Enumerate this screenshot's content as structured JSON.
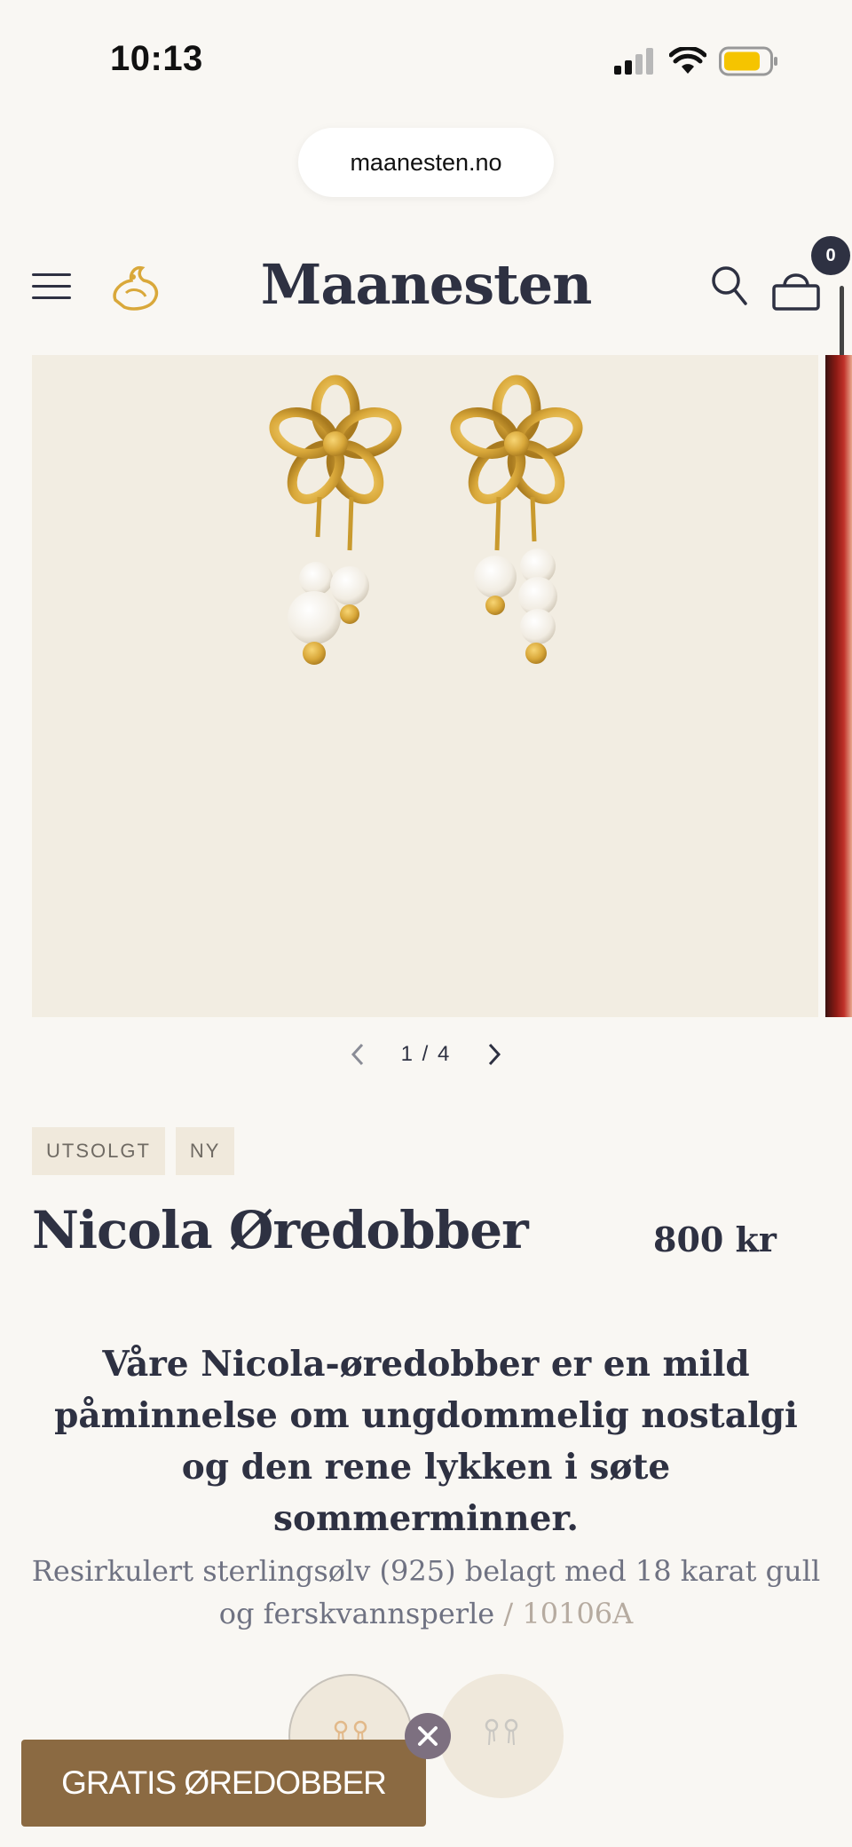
{
  "status_bar": {
    "time": "10:13"
  },
  "browser": {
    "url": "maanesten.no"
  },
  "header": {
    "brand": "Maanesten",
    "cart_count": "0"
  },
  "gallery": {
    "current": "1",
    "separator": "/",
    "total": "4"
  },
  "product": {
    "badges": [
      "UTSOLGT",
      "NY"
    ],
    "title": "Nicola Øredobber",
    "price": "800 kr",
    "description": "Våre Nicola-øredobber er en mild påminnelse om ungdommelig nostalgi og den rene lykken i søte sommerminner.",
    "material": "Resirkulert sterlingsølv (925) belagt med 18 karat gull og ferskvannsperle",
    "sku": "/ 10106A"
  },
  "promo": {
    "label": "GRATIS ØREDOBBER"
  },
  "colors": {
    "brand_dark": "#2e3142",
    "gold": "#d9a83a",
    "promo_bg": "#8b6a42",
    "image_bg": "#f2ede2"
  }
}
